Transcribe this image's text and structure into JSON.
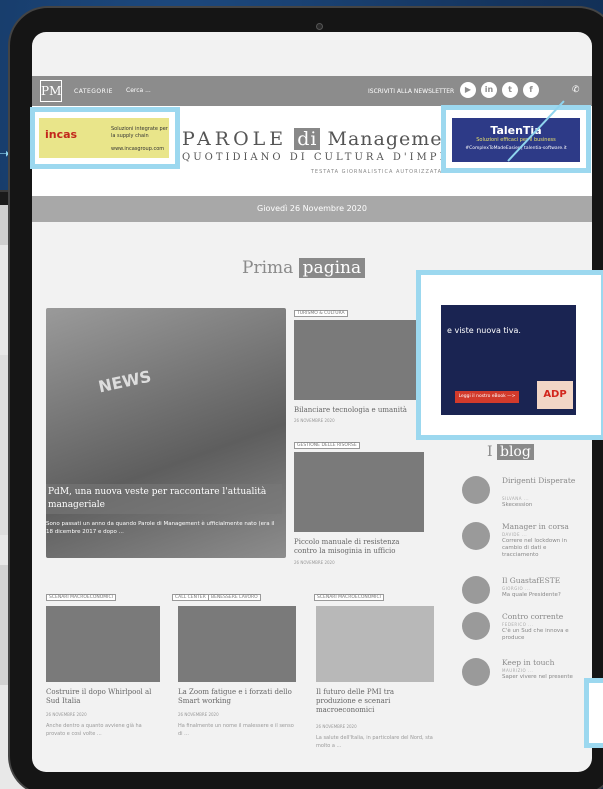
{
  "topbar": {
    "logo": "PM",
    "categories_label": "CATEGORIE",
    "search_placeholder": "Cerca ...",
    "newsletter_label": "ISCRIVITI ALLA NEWSLETTER",
    "social_icons": [
      "youtube-icon",
      "linkedin-icon",
      "twitter-icon",
      "facebook-icon",
      "phone-icon"
    ]
  },
  "ads": {
    "incas_brand": "incas",
    "incas_text": "Soluzioni integrate per la supply chain",
    "incas_url": "www.incasgroup.com",
    "talentia_brand": "TalenTia",
    "talentia_sub": "Soluzioni efficaci per il business",
    "talentia_tags": "#ComplexToMadeEasier | talentia-software.it",
    "adp_text": "e viste nuova tiva.",
    "adp_button": "Leggi il nostro eBook —>",
    "adp_logo": "ADP"
  },
  "masthead": {
    "title_a": "PAROLE",
    "title_b": "di",
    "title_c": "Management",
    "subtitle": "QUOTIDIANO DI CULTURA D'IMPRESA",
    "registered": "TESTATA GIORNALISTICA AUTORIZZATA"
  },
  "date": "Giovedì 26 Novembre 2020",
  "section": {
    "a": "Prima",
    "b": "pagina"
  },
  "hero": {
    "news_word": "NEWS",
    "title": "PdM, una nuova veste per raccontare l'attualità manageriale",
    "excerpt": "Sono passati un anno da quando Parole di Management è ufficialmente nato (era il 18 dicembre 2017 e dopo ..."
  },
  "cards": [
    {
      "tag": "TURISMO & CULTURA",
      "title": "Bilanciare tecnologia e umanità",
      "meta": "26 NOVEMBRE 2020"
    },
    {
      "tag": "GESTIONE DELLE RISORSE",
      "title": "Piccolo manuale di resistenza contro la misoginia in ufficio",
      "meta": "26 NOVEMBRE 2020"
    },
    {
      "tag": "SCENARI MACROECONOMICI",
      "title": "Costruire il dopo Whirlpool al Sud Italia",
      "meta": "26 NOVEMBRE 2020",
      "excerpt": "Anche dentro a quanto avviene già ha provato e così volte ..."
    },
    {
      "tag": "CALL CENTER",
      "tag2": "BENESSERE LAVORO",
      "title": "La Zoom fatigue e i forzati dello Smart working",
      "meta": "26 NOVEMBRE 2020",
      "excerpt": "Ha finalmente un nome il malessere e il senso di ..."
    },
    {
      "tag": "SCENARI MACROECONOMICI",
      "title": "Il futuro delle PMI tra produzione e scenari macroeconomici",
      "meta": "26 NOVEMBRE 2020",
      "excerpt": "La salute dell'Italia, in particolare del Nord, sta molto a ..."
    }
  ],
  "blog": {
    "label": "blog",
    "items": [
      {
        "title": "Dirigenti Disperate",
        "author": "SILVANA ...",
        "sub": "Skecession"
      },
      {
        "title": "Manager in corsa",
        "author": "DAVIDE ...",
        "sub": "Correre nel lockdown in cambio di dati e tracciamento"
      },
      {
        "title": "Il GuastafESTE",
        "author": "GIORGIO ...",
        "sub": "Ma quale Presidente?"
      },
      {
        "title": "Contro corrente",
        "author": "FEDERICO ...",
        "sub": "C'è un Sud che innova e produce"
      },
      {
        "title": "Keep in touch",
        "author": "MAURIZIO ...",
        "sub": "Saper vivere nel presente"
      }
    ]
  }
}
